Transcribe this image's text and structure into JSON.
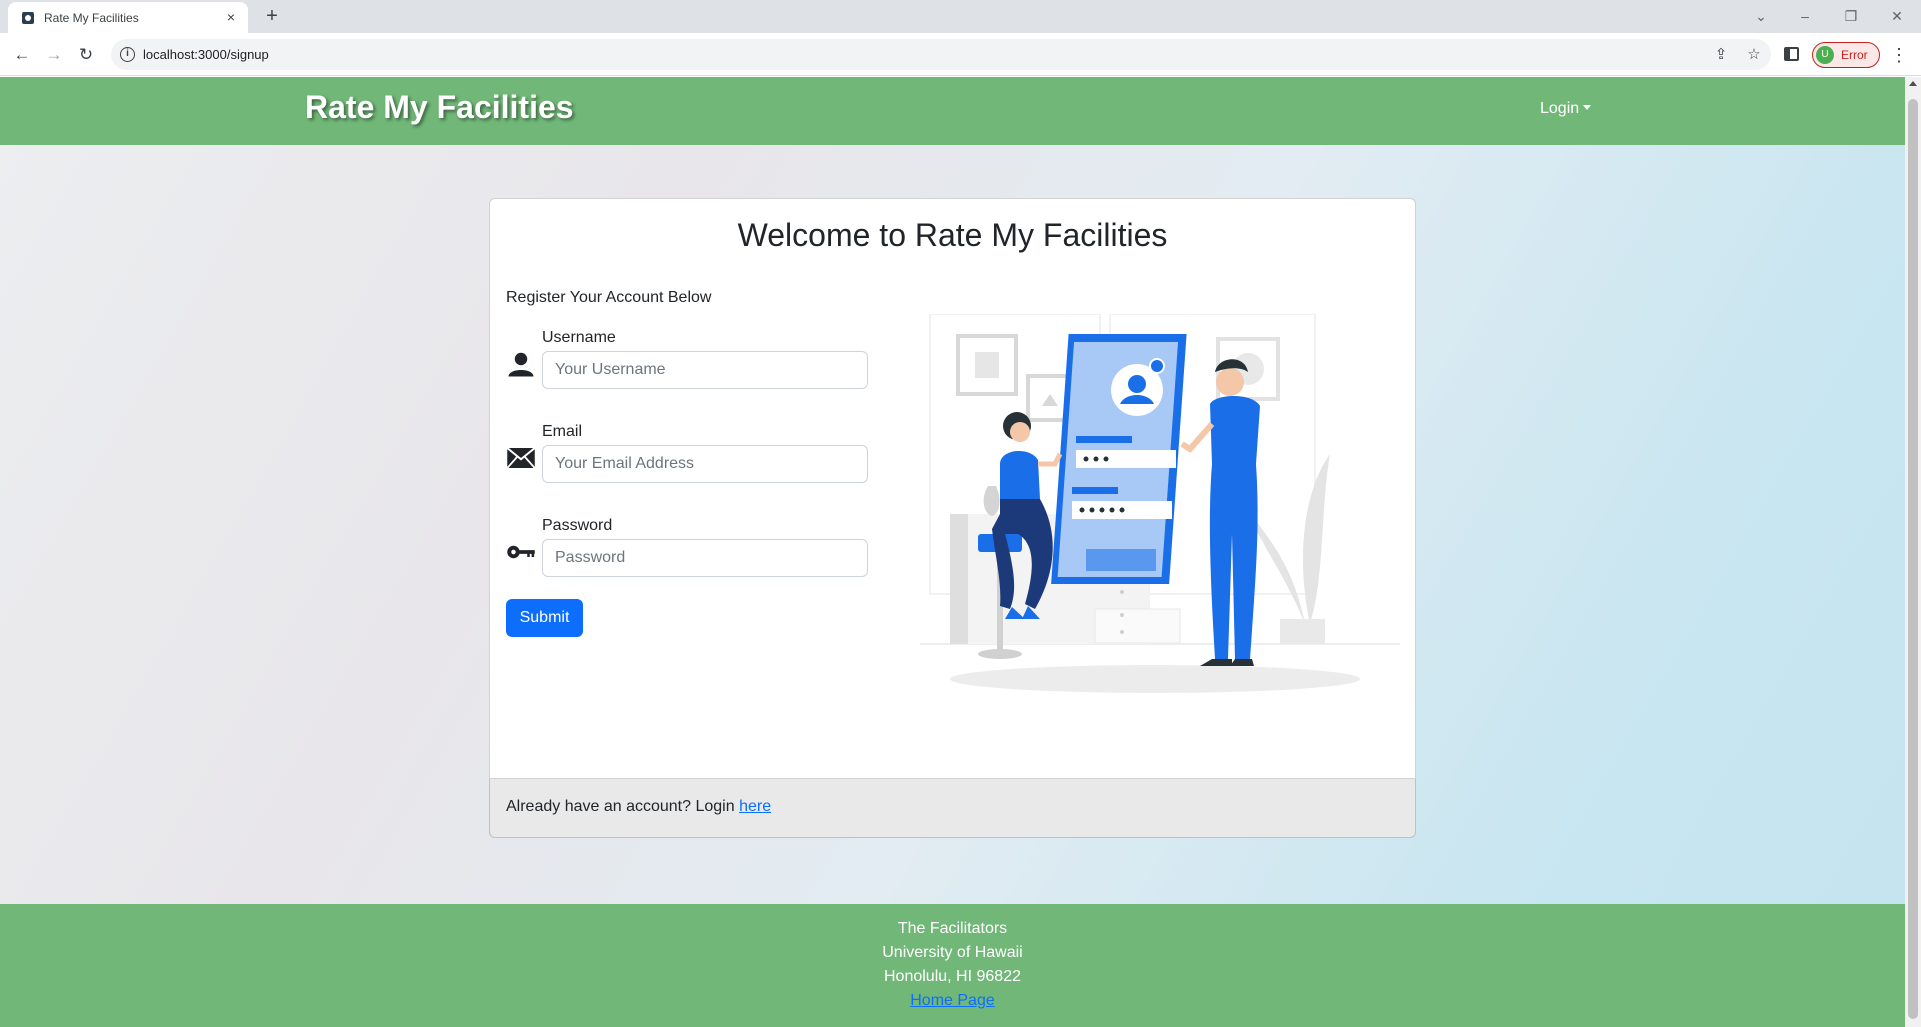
{
  "browser": {
    "tab_title": "Rate My Facilities",
    "tab_close": "×",
    "new_tab": "+",
    "url": "localhost:3000/signup",
    "profile_initial": "U",
    "profile_label": "Error"
  },
  "navbar": {
    "brand": "Rate My Facilities",
    "login_label": "Login"
  },
  "card": {
    "title": "Welcome to Rate My Facilities",
    "subtitle": "Register Your Account Below",
    "fields": {
      "username": {
        "label": "Username",
        "placeholder": "Your Username",
        "icon": "person-icon"
      },
      "email": {
        "label": "Email",
        "placeholder": "Your Email Address",
        "icon": "envelope-icon"
      },
      "password": {
        "label": "Password",
        "placeholder": "Password",
        "icon": "key-icon"
      }
    },
    "submit_label": "Submit",
    "footer_text": "Already have an account? Login ",
    "footer_link": "here"
  },
  "footer": {
    "line1": "The Facilitators",
    "line2": "University of Hawaii",
    "line3": "Honolulu, HI 96822",
    "link": "Home Page"
  },
  "colors": {
    "navbar_green": "#70b778",
    "primary_blue": "#0d6efd",
    "illustration_blue": "#1a6fe8"
  }
}
